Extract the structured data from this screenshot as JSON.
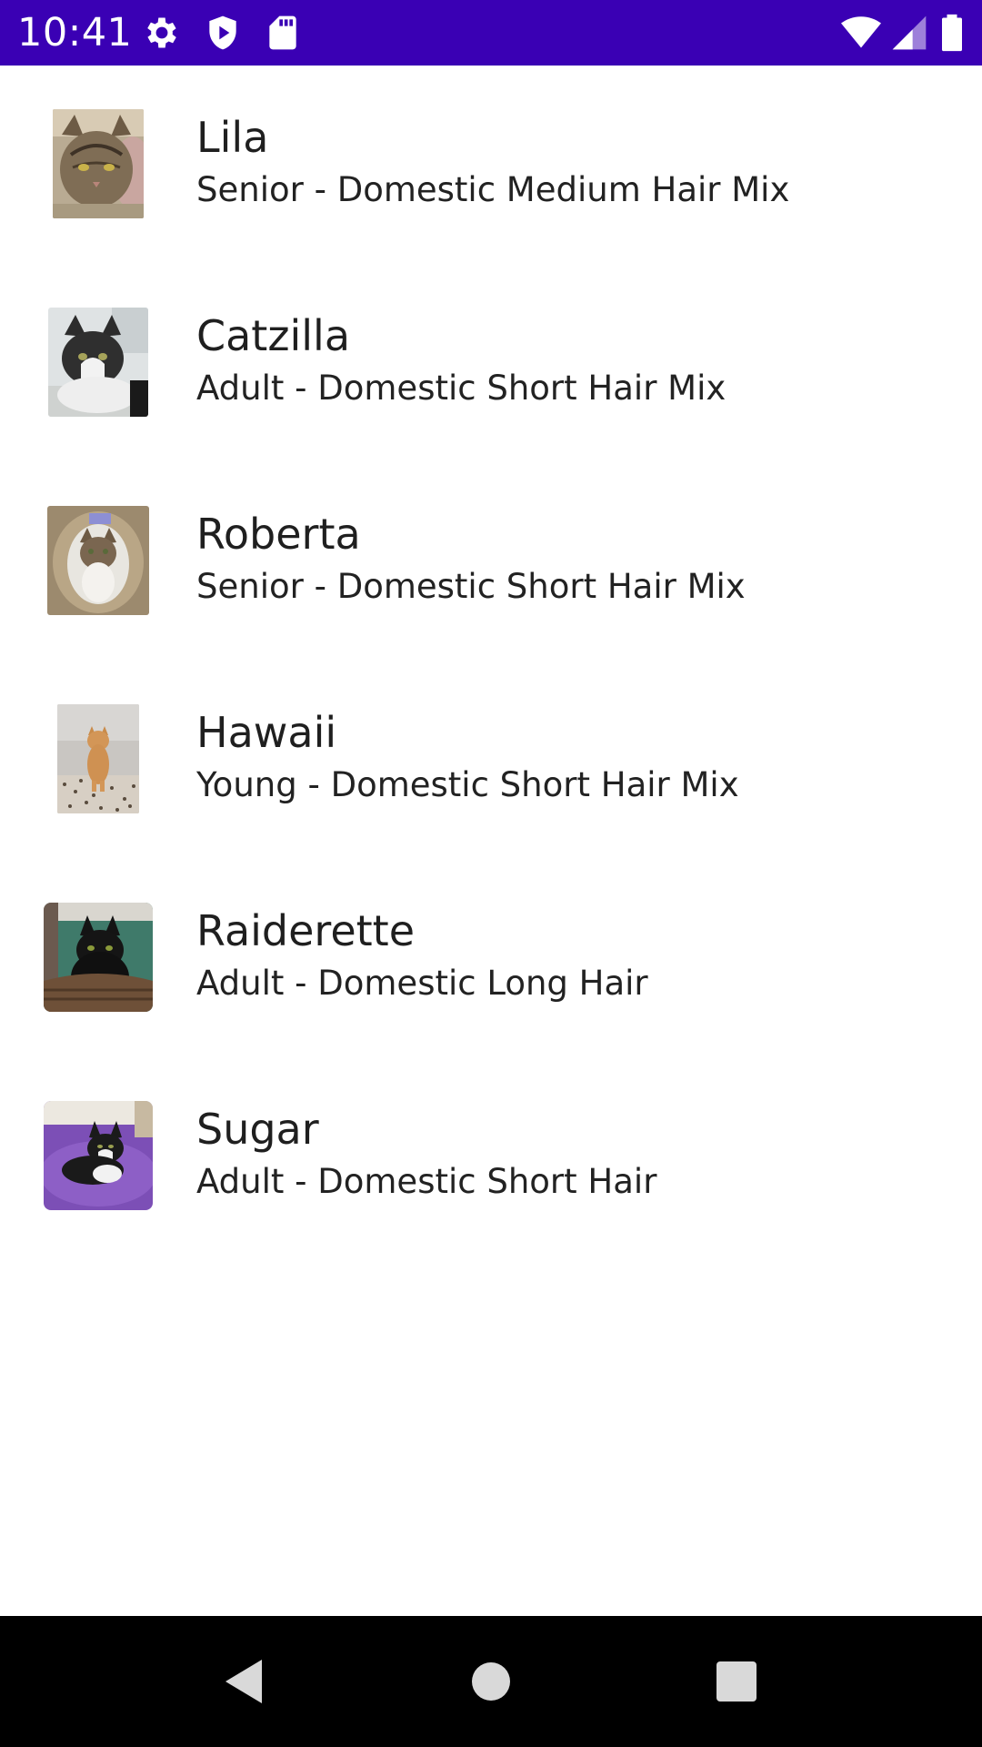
{
  "status_bar": {
    "time": "10:41",
    "background": "#3a00b4",
    "left_icons": [
      "gear-icon",
      "shield-play-icon",
      "sd-card-icon"
    ],
    "right_icons": [
      "wifi-icon",
      "cell-signal-icon",
      "battery-icon"
    ]
  },
  "cats": [
    {
      "name": "Lila",
      "description": "Senior - Domestic Medium Hair Mix",
      "photo": "tabby-cat-photo"
    },
    {
      "name": "Catzilla",
      "description": "Adult - Domestic Short Hair Mix",
      "photo": "black-white-cat-photo"
    },
    {
      "name": "Roberta",
      "description": "Senior - Domestic Short Hair Mix",
      "photo": "calico-cat-photo"
    },
    {
      "name": "Hawaii",
      "description": "Young - Domestic Short Hair Mix",
      "photo": "orange-cat-photo"
    },
    {
      "name": "Raiderette",
      "description": "Adult - Domestic Long Hair",
      "photo": "black-cat-photo"
    },
    {
      "name": "Sugar",
      "description": "Adult - Domestic Short Hair",
      "photo": "tuxedo-cat-photo"
    }
  ],
  "nav_bar": {
    "background": "#000000",
    "buttons": [
      "back-icon",
      "home-icon",
      "recents-icon"
    ]
  }
}
